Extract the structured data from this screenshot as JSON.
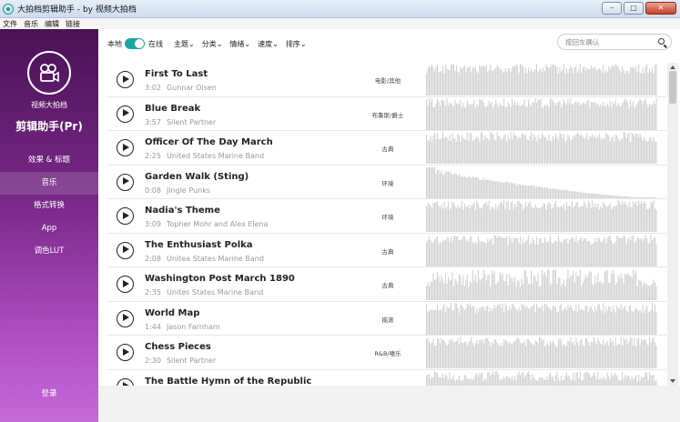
{
  "window": {
    "title": "大拍档剪辑助手 - by 视频大拍档",
    "minimize": "–",
    "maximize": "□",
    "close": "✕"
  },
  "menu": [
    "文件",
    "音乐",
    "编辑",
    "链接"
  ],
  "sidebar": {
    "brand_sub": "视频大拍档",
    "brand_main": "剪辑助手(Pr)",
    "items": [
      {
        "label": "效果 & 标题",
        "active": false
      },
      {
        "label": "音乐",
        "active": true
      },
      {
        "label": "格式转换",
        "active": false
      },
      {
        "label": "App",
        "active": false
      },
      {
        "label": "调色LUT",
        "active": false
      }
    ],
    "login": "登录"
  },
  "toolbar": {
    "local_label": "本地",
    "online_label": "在线",
    "online_on": true,
    "filters": [
      "主题",
      "分类",
      "情绪",
      "速度",
      "排序"
    ],
    "dropdown_glyph": "⌄"
  },
  "search": {
    "placeholder": "按回车确认"
  },
  "tracks": [
    {
      "title": "First To Last",
      "duration": "3:02",
      "artist": "Gunnar Olsen",
      "genre": "电影/其他",
      "wave": "dense"
    },
    {
      "title": "Blue Break",
      "duration": "3:57",
      "artist": "Silent Partner",
      "genre": "布鲁斯/爵士",
      "wave": "dense"
    },
    {
      "title": "Officer Of The Day March",
      "duration": "2:25",
      "artist": "United States Marine Band",
      "genre": "古典",
      "wave": "dense"
    },
    {
      "title": "Garden Walk (Sting)",
      "duration": "0:08",
      "artist": "Jingle Punks",
      "genre": "环境",
      "wave": "decay"
    },
    {
      "title": "Nadia's Theme",
      "duration": "3:09",
      "artist": "Topher Mohr and Alex Elena",
      "genre": "环境",
      "wave": "dense"
    },
    {
      "title": "The Enthusiast Polka",
      "duration": "2:08",
      "artist": "Unitea States Marine Band",
      "genre": "古典",
      "wave": "dense"
    },
    {
      "title": "Washington Post March 1890",
      "duration": "2:35",
      "artist": "Unites States Marine Band",
      "genre": "古典",
      "wave": "varied"
    },
    {
      "title": "World Map",
      "duration": "1:44",
      "artist": "Jason Farnham",
      "genre": "摇滚",
      "wave": "dense"
    },
    {
      "title": "Chess Pieces",
      "duration": "2:30",
      "artist": "Silent Partner",
      "genre": "R&B/嘻乐",
      "wave": "dense"
    },
    {
      "title": "The Battle Hymn of the Republic",
      "duration": "",
      "artist": "",
      "genre": "",
      "wave": "dense"
    }
  ]
}
